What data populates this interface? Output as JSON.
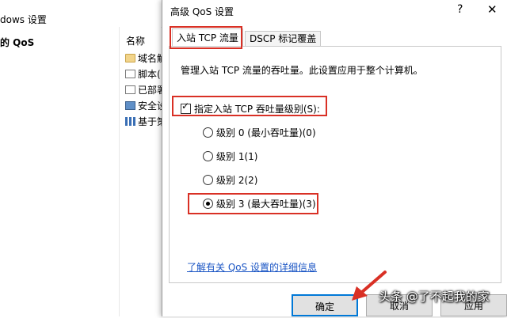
{
  "background_window": {
    "title": "dows 设置",
    "left_pane_label": "的 QoS",
    "column_header": "名称",
    "items": [
      {
        "icon": "folder-icon",
        "label": "域名解"
      },
      {
        "icon": "script-icon",
        "label": "脚本("
      },
      {
        "icon": "printer-icon",
        "label": "已部署"
      },
      {
        "icon": "security-icon",
        "label": "安全设"
      },
      {
        "icon": "chart-icon",
        "label": "基于策"
      }
    ]
  },
  "dialog": {
    "title": "高级 QoS 设置",
    "help_label": "?",
    "close_label": "✕",
    "tabs": [
      {
        "label": "入站 TCP 流量",
        "selected": true
      },
      {
        "label": "DSCP 标记覆盖",
        "selected": false
      }
    ],
    "panel": {
      "description": "管理入站 TCP 流量的吞吐量。此设置应用于整个计算机。",
      "specify_checkbox": {
        "label": "指定入站 TCP 吞吐量级别(S):",
        "checked": true
      },
      "levels": [
        {
          "label": "级别 0 (最小吞吐量)(0)",
          "selected": false
        },
        {
          "label": "级别 1(1)",
          "selected": false
        },
        {
          "label": "级别 2(2)",
          "selected": false
        },
        {
          "label": "级别 3 (最大吞吐量)(3)",
          "selected": true
        }
      ],
      "learn_more_link": "了解有关 QoS 设置的详细信息"
    },
    "buttons": {
      "ok": "确定",
      "cancel": "取消",
      "apply": "应用"
    }
  },
  "annotation_color": "#d93025",
  "watermark": "头条 @了不起我的家"
}
